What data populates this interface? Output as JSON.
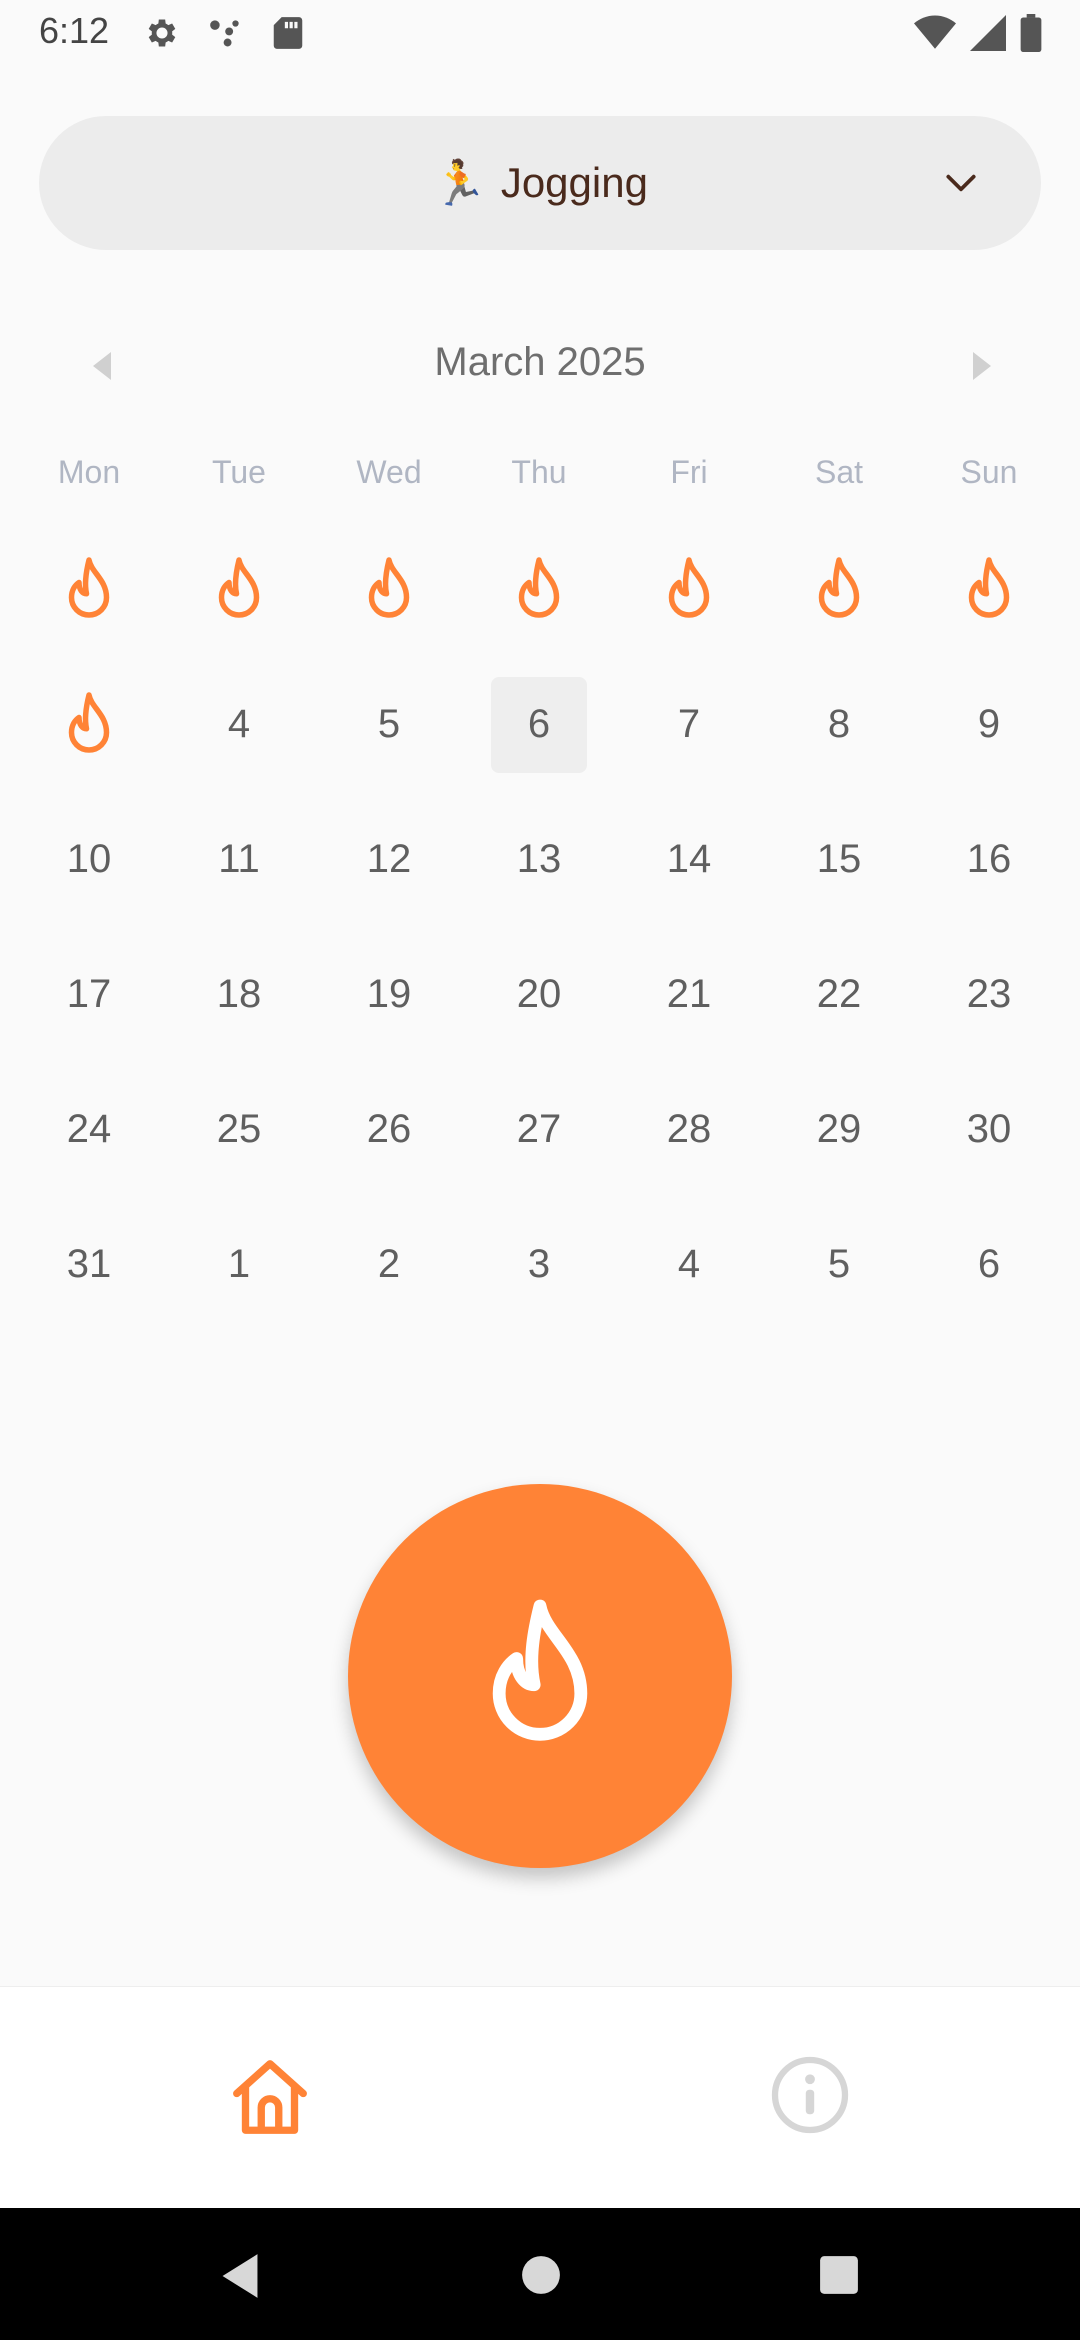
{
  "status_bar": {
    "time": "6:12",
    "left_icons": [
      "gear-icon",
      "dots-icon",
      "sdcard-icon"
    ],
    "right_icons": [
      "wifi-icon",
      "signal-icon",
      "battery-icon"
    ]
  },
  "activity": {
    "emoji": "🏃",
    "label": "Jogging"
  },
  "calendar": {
    "month_title": "March 2025",
    "weekdays": [
      "Mon",
      "Tue",
      "Wed",
      "Thu",
      "Fri",
      "Sat",
      "Sun"
    ],
    "weeks": [
      [
        {
          "fire": true
        },
        {
          "fire": true
        },
        {
          "fire": true
        },
        {
          "fire": true
        },
        {
          "fire": true
        },
        {
          "fire": true
        },
        {
          "fire": true
        }
      ],
      [
        {
          "fire": true
        },
        {
          "day": "4"
        },
        {
          "day": "5"
        },
        {
          "day": "6",
          "today": true
        },
        {
          "day": "7"
        },
        {
          "day": "8"
        },
        {
          "day": "9"
        }
      ],
      [
        {
          "day": "10"
        },
        {
          "day": "11"
        },
        {
          "day": "12"
        },
        {
          "day": "13"
        },
        {
          "day": "14"
        },
        {
          "day": "15"
        },
        {
          "day": "16"
        }
      ],
      [
        {
          "day": "17"
        },
        {
          "day": "18"
        },
        {
          "day": "19"
        },
        {
          "day": "20"
        },
        {
          "day": "21"
        },
        {
          "day": "22"
        },
        {
          "day": "23"
        }
      ],
      [
        {
          "day": "24"
        },
        {
          "day": "25"
        },
        {
          "day": "26"
        },
        {
          "day": "27"
        },
        {
          "day": "28"
        },
        {
          "day": "29"
        },
        {
          "day": "30"
        }
      ],
      [
        {
          "day": "31"
        },
        {
          "day": "1"
        },
        {
          "day": "2"
        },
        {
          "day": "3"
        },
        {
          "day": "4"
        },
        {
          "day": "5"
        },
        {
          "day": "6"
        }
      ]
    ]
  },
  "colors": {
    "accent": "#ff8336",
    "fire_outline": "#ff8336",
    "weekday": "#b0b6c3",
    "inactive_nav": "#d6d6d6"
  },
  "bottom_nav": {
    "items": [
      {
        "icon": "home-icon",
        "active": true
      },
      {
        "icon": "info-icon",
        "active": false
      }
    ]
  }
}
